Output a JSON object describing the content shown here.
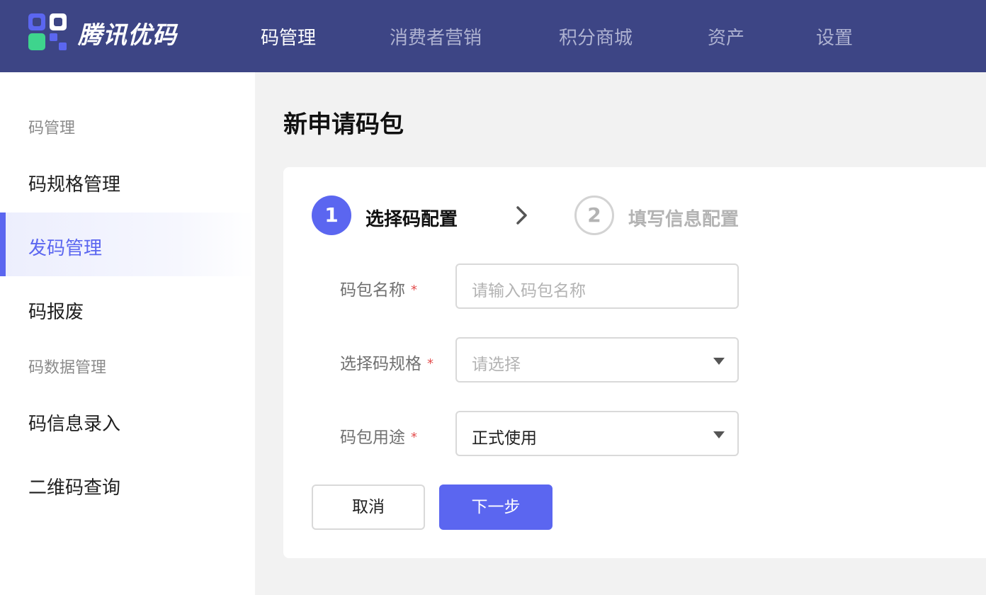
{
  "header": {
    "brand": "腾讯优码",
    "nav": [
      "码管理",
      "消费者营销",
      "积分商城",
      "资产",
      "设置"
    ],
    "active_nav": "码管理",
    "colors": {
      "bar": "#3d4585",
      "logo_green": "#3ed48d",
      "logo_blue": "#5b66f0",
      "logo_white": "#ffffff"
    }
  },
  "sidebar": {
    "group1": "码管理",
    "items1": [
      "码规格管理",
      "发码管理",
      "码报废"
    ],
    "active_item": "发码管理",
    "group2": "码数据管理",
    "items2": [
      "码信息录入",
      "二维码查询"
    ]
  },
  "page": {
    "title": "新申请码包"
  },
  "steps": [
    {
      "number": "1",
      "label": "选择码配置",
      "state": "active"
    },
    {
      "number": "2",
      "label": "填写信息配置",
      "state": "inactive"
    }
  ],
  "form": {
    "name": {
      "label": "码包名称",
      "required": "*",
      "placeholder": "请输入码包名称",
      "value": ""
    },
    "spec": {
      "label": "选择码规格",
      "required": "*",
      "placeholder": "请选择",
      "value": ""
    },
    "purpose": {
      "label": "码包用途",
      "required": "*",
      "value": "正式使用"
    }
  },
  "buttons": {
    "cancel": "取消",
    "next": "下一步"
  },
  "accent_color": "#5b66f0"
}
